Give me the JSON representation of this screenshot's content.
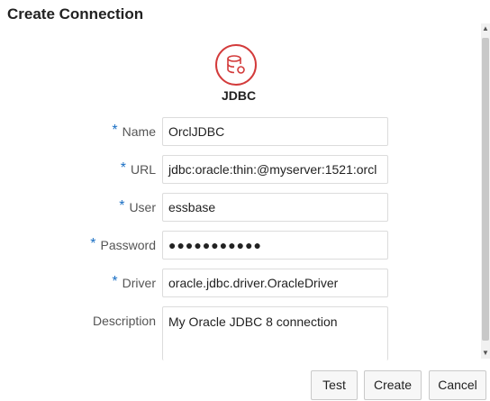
{
  "dialog": {
    "title": "Create Connection"
  },
  "connection_type": {
    "label": "JDBC",
    "icon": "database-icon",
    "accent": "#d33b3b"
  },
  "required_color": "#1a6fc4",
  "form": {
    "fields": [
      {
        "label": "Name",
        "required": true,
        "value": "OrclJDBC"
      },
      {
        "label": "URL",
        "required": true,
        "value": "jdbc:oracle:thin:@myserver:1521:orcl"
      },
      {
        "label": "User",
        "required": true,
        "value": "essbase"
      },
      {
        "label": "Password",
        "required": true,
        "value": "●●●●●●●●●●●"
      },
      {
        "label": "Driver",
        "required": true,
        "value": "oracle.jdbc.driver.OracleDriver"
      },
      {
        "label": "Description",
        "required": false,
        "value": "My Oracle JDBC 8 connection"
      }
    ],
    "required_marker": "*"
  },
  "buttons": {
    "test": "Test",
    "create": "Create",
    "cancel": "Cancel"
  }
}
